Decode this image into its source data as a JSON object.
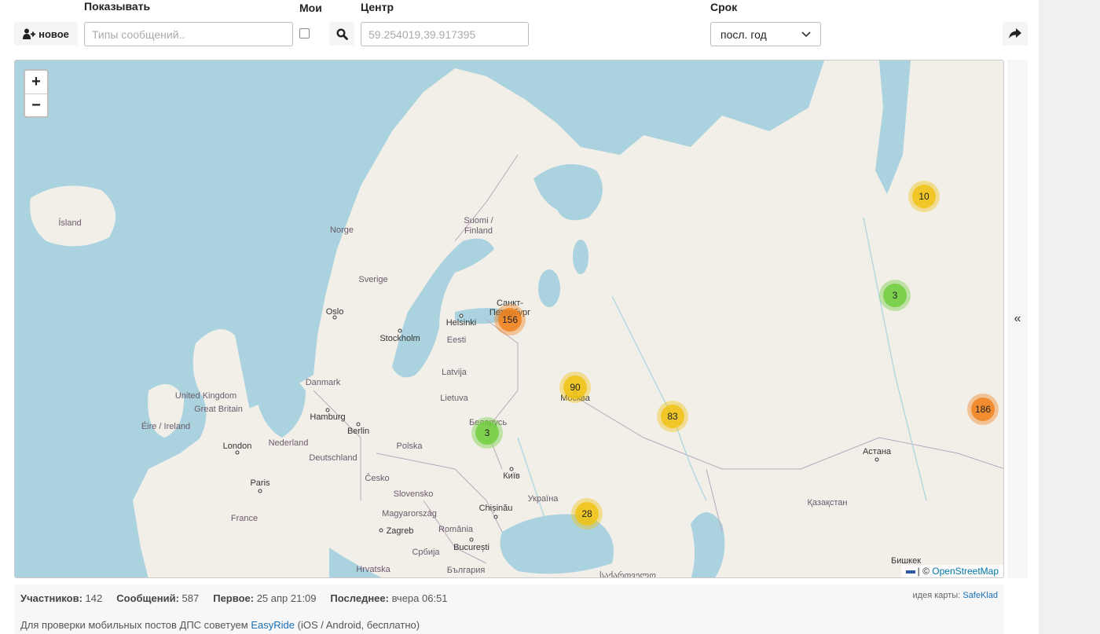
{
  "toolbar": {
    "new_button": "новое",
    "show_label": "Показывать",
    "types_placeholder": "Типы сообщений..",
    "mine_label": "Мои",
    "center_label": "Центр",
    "center_value": "59.254019,39.917395",
    "period_label": "Срок",
    "period_value": "посл. год"
  },
  "map": {
    "zoom_in": "+",
    "zoom_out": "−",
    "places": [
      {
        "name": "Ísland",
        "type": "country"
      },
      {
        "name": "Norge",
        "type": "country"
      },
      {
        "name": "Sverige",
        "type": "country"
      },
      {
        "name": "Suomi /",
        "type": "country"
      },
      {
        "name": "Finland",
        "type": "country"
      },
      {
        "name": "Eesti",
        "type": "country"
      },
      {
        "name": "Latvija",
        "type": "country"
      },
      {
        "name": "Lietuva",
        "type": "country"
      },
      {
        "name": "Danmark",
        "type": "country"
      },
      {
        "name": "United Kingdom",
        "type": "country"
      },
      {
        "name": "Great Britain",
        "type": "country"
      },
      {
        "name": "Éire / Ireland",
        "type": "country"
      },
      {
        "name": "Nederland",
        "type": "country"
      },
      {
        "name": "Deutschland",
        "type": "country"
      },
      {
        "name": "Polska",
        "type": "country"
      },
      {
        "name": "Česko",
        "type": "country"
      },
      {
        "name": "Slovensko",
        "type": "country"
      },
      {
        "name": "France",
        "type": "country"
      },
      {
        "name": "Magyarország",
        "type": "country"
      },
      {
        "name": "Hrvatska",
        "type": "country"
      },
      {
        "name": "Србија",
        "type": "country"
      },
      {
        "name": "România",
        "type": "country"
      },
      {
        "name": "България",
        "type": "country"
      },
      {
        "name": "Україна",
        "type": "country"
      },
      {
        "name": "Беларусь",
        "type": "country"
      },
      {
        "name": "Қазақстан",
        "type": "country"
      },
      {
        "name": "Oslo",
        "type": "city"
      },
      {
        "name": "Stockholm",
        "type": "city"
      },
      {
        "name": "Helsinki",
        "type": "city"
      },
      {
        "name": "Санкт-",
        "type": "city"
      },
      {
        "name": "Петербург",
        "type": "city"
      },
      {
        "name": "Москва",
        "type": "city"
      },
      {
        "name": "Hamburg",
        "type": "city"
      },
      {
        "name": "Berlin",
        "type": "city"
      },
      {
        "name": "London",
        "type": "city"
      },
      {
        "name": "Paris",
        "type": "city"
      },
      {
        "name": "Київ",
        "type": "city"
      },
      {
        "name": "Chișinău",
        "type": "city"
      },
      {
        "name": "Zagreb",
        "type": "city"
      },
      {
        "name": "București",
        "type": "city"
      },
      {
        "name": "Астана",
        "type": "city"
      },
      {
        "name": "Бишкек",
        "type": "city"
      },
      {
        "name": "საქართველო",
        "type": "country"
      }
    ],
    "clusters": [
      {
        "count": "156",
        "level": "large"
      },
      {
        "count": "90",
        "level": "medium"
      },
      {
        "count": "83",
        "level": "medium"
      },
      {
        "count": "186",
        "level": "large"
      },
      {
        "count": "28",
        "level": "medium"
      },
      {
        "count": "10",
        "level": "medium"
      },
      {
        "count": "3",
        "level": "small"
      },
      {
        "count": "3",
        "level": "small"
      }
    ],
    "attribution_sep": "| ©",
    "attribution_link": "OpenStreetMap",
    "cluster_colors": {
      "small": "#6ecc39",
      "medium": "#f0c20c",
      "large": "#f18017"
    }
  },
  "sidebar_toggle": "«",
  "stats": {
    "participants_label": "Участников:",
    "participants_value": "142",
    "messages_label": "Сообщений:",
    "messages_value": "587",
    "first_label": "Первое:",
    "first_value": "25 апр 21:09",
    "last_label": "Последнее:",
    "last_value": "вчера 06:51",
    "credit_label": "идея карты:",
    "credit_link": "SafeKlad",
    "tip_prefix": "Для проверки мобильных постов ДПС советуем",
    "tip_link": "EasyRide",
    "tip_suffix": "(iOS / Android, бесплатно)"
  }
}
